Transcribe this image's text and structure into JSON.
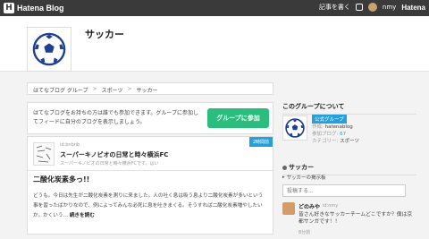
{
  "topbar": {
    "logo_mark": "H",
    "logo_text": "Hatena Blog",
    "write_label": "記事を書く",
    "user": "nmy",
    "brand": "Hatena"
  },
  "group": {
    "title": "サッカー"
  },
  "breadcrumb": [
    "はてなブログ グループ",
    "スポーツ",
    "サッカー"
  ],
  "breadcrumb_sep": ">",
  "join": {
    "message": "はてなブログをお持ちの方は誰でも参加できます。グループに参加してフィードに自分のブログを表示しましょう。",
    "button": "グループに参加"
  },
  "post": {
    "author": "id:bnbnb",
    "blog_name": "スーパーキノピオの日常と時々横浜FC",
    "blog_desc": "スーパーキノピオの日常と時々横浜FCです。はい",
    "time_ago": "2時間前",
    "title": "二酸化炭素多っ!!",
    "body": "どうも。今日は先生が二酸化炭素を測りに来ました。人の吐く息は吸う息より二酸化炭素が多いという事を習ったばかりなので、例によってみんな必死に息を吐きまくる。そうすれば二酸化炭素増やしたいか。かくいう…",
    "more": "続きを読む"
  },
  "sidebar": {
    "about_title": "このグループについて",
    "official_badge": "公式グループ",
    "creator_label": "作成:",
    "creator": "hatenablog",
    "blogs_label": "参加ブログ:",
    "blogs_count": "67",
    "category_label": "カテゴリー:",
    "category": "スポーツ",
    "board_title": "サッカー",
    "board_link": "サッカーの掲示板",
    "post_placeholder": "投稿する...",
    "comment_name": "どのみや",
    "comment_id": "id:nmy",
    "comment_text": "皆さん好きなサッカーチームどこですか？僕は京都サンガです！！",
    "comment_ago": "8分前"
  },
  "colors": {
    "topbar": "#3a3a3a",
    "accent": "#26a0da",
    "join_button": "#2bbd7e"
  }
}
